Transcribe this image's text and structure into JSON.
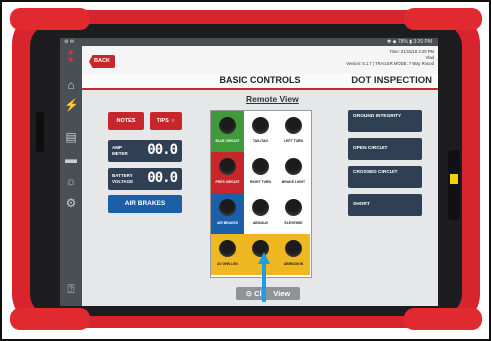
{
  "status_bar": {
    "left": "⚙ ✉",
    "right": "✱ ◆ 78% ▮ 3:20 PM"
  },
  "header": {
    "back_label": "BACK",
    "time_line": "Time: 01/15/18 3:20 PM",
    "user_line": "Vlad",
    "version_line": "Version: 5.1.7 | TRAILER MODE: 7 Way Round",
    "title": "BASIC CONTROLS",
    "right_title": "DOT INSPECTION"
  },
  "sidebar_icons": [
    "home-icon",
    "gauge-icon",
    "clipboard-icon",
    "folder-icon",
    "bulb-icon",
    "settings-icon",
    "help-icon"
  ],
  "left_controls": {
    "notes_label": "NOTES",
    "tips_label": "TIPS",
    "amp_meter": {
      "label": "AMP METER",
      "value": "00.0"
    },
    "battery_voltage": {
      "label": "BATTERY VOLTAGE",
      "value": "00.0"
    },
    "air_brakes_label": "AIR BRAKES"
  },
  "remote_view": {
    "title": "Remote View",
    "cells": [
      {
        "label": "BLUE CIRCUIT",
        "color": "#3f9a3a"
      },
      {
        "label": "TAIL/TAG",
        "color": "#ffffff"
      },
      {
        "label": "LEFT TURN",
        "color": "#ffffff"
      },
      {
        "label": "PRES CIRCUIT",
        "color": "#c9262b"
      },
      {
        "label": "RIGHT TURN",
        "color": "#ffffff"
      },
      {
        "label": "BRAKE LIGHT",
        "color": "#ffffff"
      },
      {
        "label": "AIR BRAKES",
        "color": "#1b5fa8"
      },
      {
        "label": "ABS/AUX",
        "color": "#ffffff"
      },
      {
        "label": "ELEVENSE",
        "color": "#ffffff"
      },
      {
        "label": "AV GRN LEN",
        "color": "#efb720"
      },
      {
        "label": "",
        "color": "#efb720"
      },
      {
        "label": "ABRIDGION",
        "color": "#efb720"
      }
    ]
  },
  "right_controls": [
    "GROUND INTEGRITY",
    "OPEN CIRCUIT",
    "CROSSED CIRCUIT",
    "SHORT"
  ],
  "classic_view_label": "Cla View",
  "colors": {
    "case": "#d8242c",
    "accent_red": "#c9262b",
    "navy": "#2f3f54",
    "blue": "#1b5fa8",
    "yellow": "#efb720",
    "arrow": "#1e9de0"
  }
}
